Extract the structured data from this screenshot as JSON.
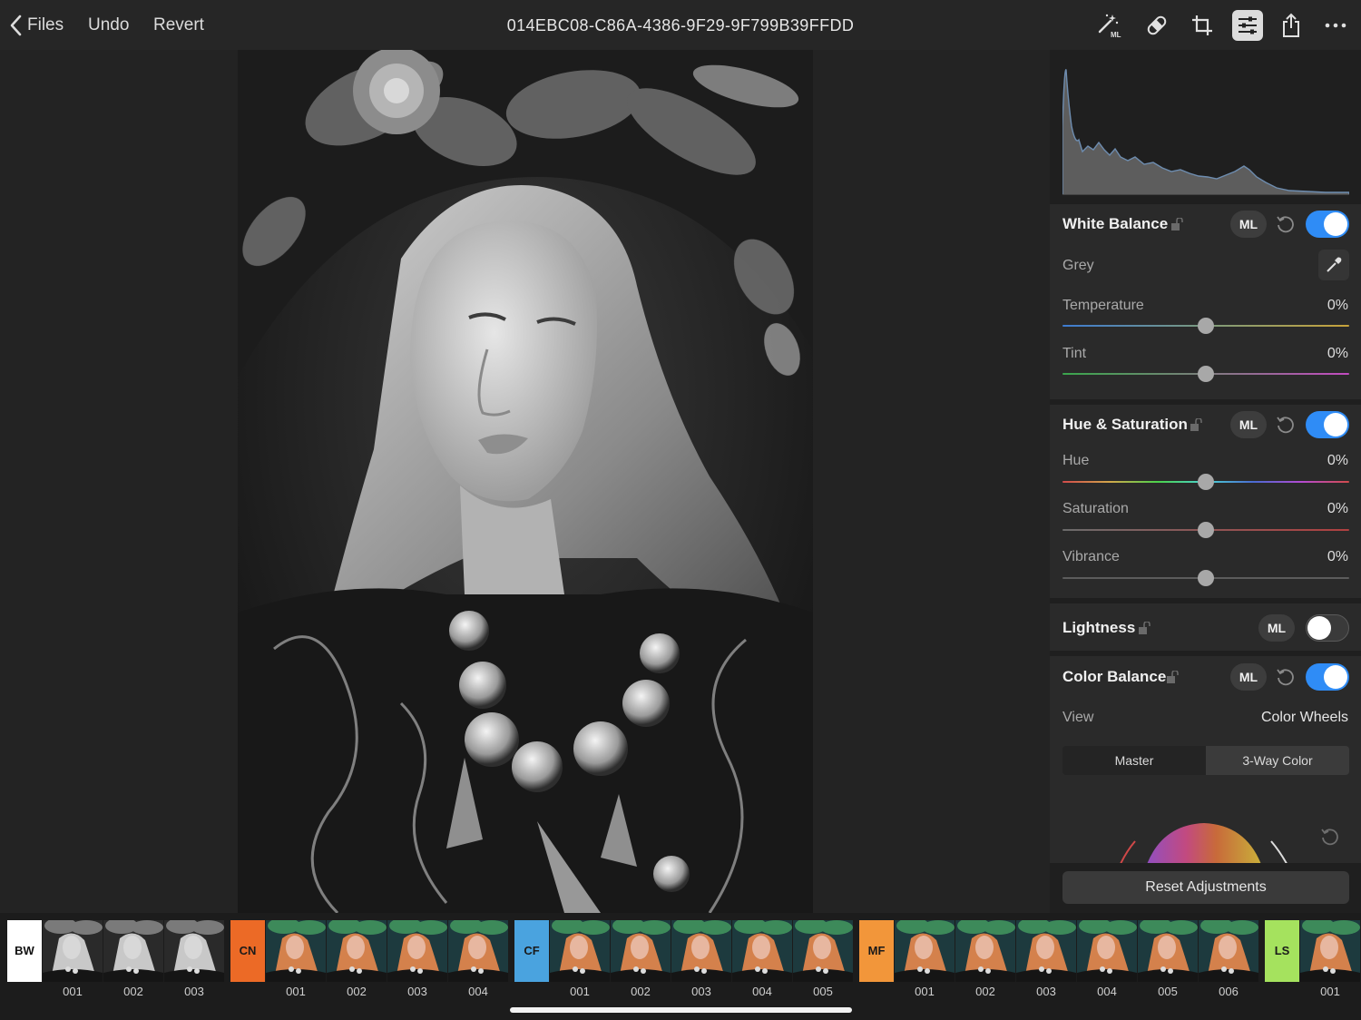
{
  "topbar": {
    "back_label": "Files",
    "undo_label": "Undo",
    "revert_label": "Revert",
    "title": "014EBC08-C86A-4386-9F29-9F799B39FFDD",
    "tools": [
      {
        "name": "ml-wand-icon",
        "ml_text": "ML"
      },
      {
        "name": "bandage-icon"
      },
      {
        "name": "crop-icon"
      },
      {
        "name": "adjustments-icon",
        "active": true
      },
      {
        "name": "share-icon"
      },
      {
        "name": "more-icon"
      }
    ]
  },
  "panel": {
    "white_balance": {
      "title": "White Balance",
      "ml": "ML",
      "enabled": true,
      "grey_label": "Grey",
      "temperature": {
        "label": "Temperature",
        "value": "0%",
        "position": 0.5
      },
      "tint": {
        "label": "Tint",
        "value": "0%",
        "position": 0.5
      }
    },
    "hue_saturation": {
      "title": "Hue & Saturation",
      "ml": "ML",
      "enabled": true,
      "hue": {
        "label": "Hue",
        "value": "0%",
        "position": 0.5
      },
      "saturation": {
        "label": "Saturation",
        "value": "0%",
        "position": 0.5
      },
      "vibrance": {
        "label": "Vibrance",
        "value": "0%",
        "position": 0.5
      }
    },
    "lightness": {
      "title": "Lightness",
      "ml": "ML",
      "enabled": false
    },
    "color_balance": {
      "title": "Color Balance",
      "ml": "ML",
      "enabled": true,
      "view_label": "View",
      "view_value": "Color Wheels",
      "segments": [
        "Master",
        "3-Way Color"
      ]
    },
    "reset_label": "Reset Adjustments"
  },
  "filmstrip": {
    "groups": [
      {
        "badge": "BW",
        "badge_color": "#ffffff",
        "text_color": "#111111",
        "tone": "mono",
        "thumbs": [
          "001",
          "002",
          "003"
        ]
      },
      {
        "badge": "CN",
        "badge_color": "#ec6a26",
        "text_color": "#1a1a1a",
        "tone": "color",
        "thumbs": [
          "001",
          "002",
          "003",
          "004"
        ]
      },
      {
        "badge": "CF",
        "badge_color": "#4aa3df",
        "text_color": "#1a1a1a",
        "tone": "color",
        "thumbs": [
          "001",
          "002",
          "003",
          "004",
          "005"
        ]
      },
      {
        "badge": "MF",
        "badge_color": "#f2963a",
        "text_color": "#1a1a1a",
        "tone": "color",
        "thumbs": [
          "001",
          "002",
          "003",
          "004",
          "005",
          "006"
        ]
      },
      {
        "badge": "LS",
        "badge_color": "#a5e25e",
        "text_color": "#1a1a1a",
        "tone": "color",
        "thumbs": [
          "001"
        ]
      }
    ]
  }
}
